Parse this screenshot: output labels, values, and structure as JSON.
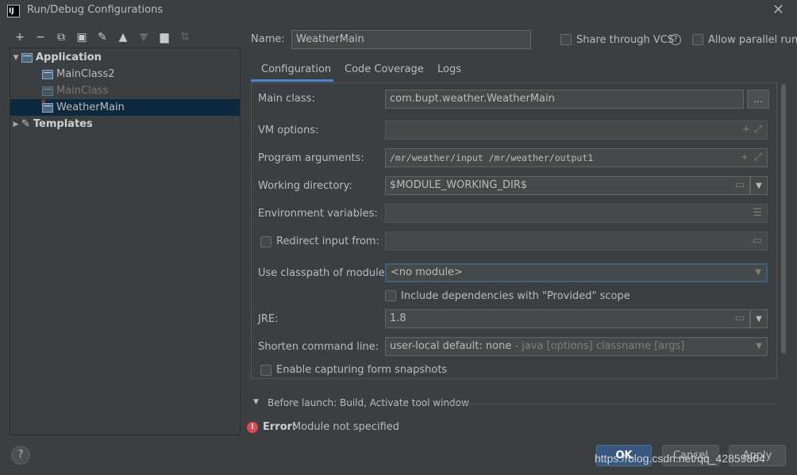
{
  "window": {
    "title": "Run/Debug Configurations",
    "logo": "IJ"
  },
  "toolbar": {
    "icons": [
      "add-icon",
      "remove-icon",
      "copy-icon",
      "save-icon",
      "wrench-icon",
      "move-up-icon",
      "move-down-icon",
      "folder-add-icon",
      "sort-icon"
    ]
  },
  "tree": {
    "application": "Application",
    "items": [
      "MainClass2",
      "MainClass",
      "WeatherMain"
    ],
    "templates": "Templates"
  },
  "name_row": {
    "label": "Name:",
    "value": "WeatherMain",
    "share_vcs": "Share through VCS",
    "parallel": "Allow parallel run"
  },
  "tabs": [
    "Configuration",
    "Code Coverage",
    "Logs"
  ],
  "form": {
    "main_class_label": "Main class:",
    "main_class": "com.bupt.weather.WeatherMain",
    "main_class_btn": "...",
    "vm_label": "VM options:",
    "vm_value": "",
    "args_label": "Program arguments:",
    "args_value": "/mr/weather/input /mr/weather/output1",
    "workdir_label": "Working directory:",
    "workdir_value": "$MODULE_WORKING_DIR$",
    "env_label": "Environment variables:",
    "env_value": "",
    "redirect_label": "Redirect input from:",
    "redirect_value": "",
    "classpath_label": "Use classpath of module:",
    "classpath_value": "<no module>",
    "include_deps": "Include dependencies with \"Provided\" scope",
    "jre_label": "JRE:",
    "jre_value": "1.8",
    "shorten_label": "Shorten command line:",
    "shorten_value": "user-local default: none",
    "shorten_hint": " - java [options] classname [args]",
    "capture_forms": "Enable capturing form snapshots"
  },
  "before_launch": "Before launch: Build, Activate tool window",
  "error": {
    "prefix": "Error:",
    "message": "Module not specified"
  },
  "buttons": {
    "help": "?",
    "ok": "OK",
    "cancel": "Cancel",
    "apply": "Apply"
  },
  "watermark": "https://blog.csdn.net/qq_42859864",
  "colors": {
    "background": "#3c3f41",
    "selection": "#0d293e",
    "accent": "#4a88c7",
    "error": "#e0464c"
  }
}
